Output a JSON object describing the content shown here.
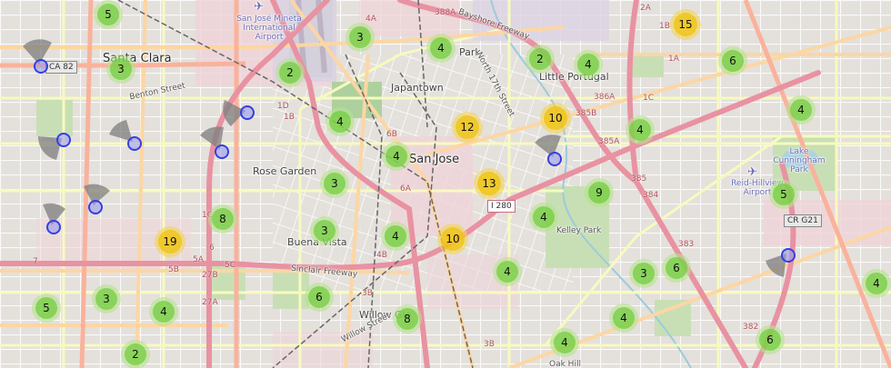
{
  "map": {
    "place_labels": [
      {
        "name": "santa-clara-label",
        "text": "Santa Clara",
        "cls": "city"
      },
      {
        "name": "san-jose-label",
        "text": "San Jose",
        "cls": "city"
      },
      {
        "name": "japantown-label",
        "text": "Japantown",
        "cls": "nb"
      },
      {
        "name": "little-portugal-label",
        "text": "Little Portugal",
        "cls": "nb"
      },
      {
        "name": "rose-garden-label",
        "text": "Rose Garden",
        "cls": "nb"
      },
      {
        "name": "buena-vista-label",
        "text": "Buena Vista",
        "cls": "nb"
      },
      {
        "name": "willow-glen-label",
        "text": "Willow Gle",
        "cls": "nb"
      },
      {
        "name": "kelley-park-label",
        "text": "Kelley Park",
        "cls": "small"
      },
      {
        "name": "park-label",
        "text": "Park",
        "cls": "nb"
      },
      {
        "name": "oak-hill-label",
        "text": "Oak Hill",
        "cls": "small"
      },
      {
        "name": "benton-street-label",
        "text": "Benton Street",
        "cls": "small"
      },
      {
        "name": "bayshore-freeway-label",
        "text": "Bayshore Freeway",
        "cls": "small"
      },
      {
        "name": "sinclair-freeway-label",
        "text": "Sinclair Freeway",
        "cls": "small"
      },
      {
        "name": "willow-street-label",
        "text": "Willow Street",
        "cls": "small"
      },
      {
        "name": "north-17th-street-label",
        "text": "North 17th Street",
        "cls": "small"
      },
      {
        "name": "lake-cunningham-park-label",
        "text": "Lake Cunningham Park",
        "cls": "blue"
      },
      {
        "name": "reid-hillview-airport-label",
        "text": "Reid-Hillview Airport",
        "cls": "blue"
      },
      {
        "name": "sjc-airport-label",
        "text": "San José Mineta International Airport",
        "cls": "blue"
      }
    ],
    "shields": [
      {
        "name": "ca-82-shield",
        "text": "CA 82"
      },
      {
        "name": "i-280-shield",
        "text": "I 280"
      },
      {
        "name": "cr-g21-shield",
        "text": "CR G21"
      },
      {
        "name": "exit-388a-label",
        "text": "388A"
      }
    ],
    "exits": [
      "1D",
      "1B",
      "1C",
      "5C",
      "5B",
      "5A",
      "27B",
      "27A",
      "6B",
      "6A",
      "4A",
      "4B",
      "3B",
      "385B",
      "385A",
      "386A",
      "385",
      "384",
      "383",
      "382",
      "2A",
      "1C",
      "1B",
      "1A",
      "6",
      "7",
      "3B"
    ],
    "clusters": [
      {
        "count": "5",
        "color": "green"
      },
      {
        "count": "3",
        "color": "green"
      },
      {
        "count": "3",
        "color": "green"
      },
      {
        "count": "2",
        "color": "green"
      },
      {
        "count": "4",
        "color": "green"
      },
      {
        "count": "2",
        "color": "green"
      },
      {
        "count": "4",
        "color": "green"
      },
      {
        "count": "15",
        "color": "yellow"
      },
      {
        "count": "6",
        "color": "green"
      },
      {
        "count": "4",
        "color": "green"
      },
      {
        "count": "12",
        "color": "yellow"
      },
      {
        "count": "10",
        "color": "yellow"
      },
      {
        "count": "4",
        "color": "green"
      },
      {
        "count": "4",
        "color": "green"
      },
      {
        "count": "4",
        "color": "green"
      },
      {
        "count": "3",
        "color": "green"
      },
      {
        "count": "13",
        "color": "yellow"
      },
      {
        "count": "9",
        "color": "green"
      },
      {
        "count": "5",
        "color": "green"
      },
      {
        "count": "8",
        "color": "green"
      },
      {
        "count": "3",
        "color": "green"
      },
      {
        "count": "4",
        "color": "green"
      },
      {
        "count": "10",
        "color": "yellow"
      },
      {
        "count": "4",
        "color": "green"
      },
      {
        "count": "19",
        "color": "yellow"
      },
      {
        "count": "4",
        "color": "green"
      },
      {
        "count": "3",
        "color": "green"
      },
      {
        "count": "6",
        "color": "green"
      },
      {
        "count": "4",
        "color": "green"
      },
      {
        "count": "5",
        "color": "green"
      },
      {
        "count": "3",
        "color": "green"
      },
      {
        "count": "4",
        "color": "green"
      },
      {
        "count": "6",
        "color": "green"
      },
      {
        "count": "8",
        "color": "green"
      },
      {
        "count": "4",
        "color": "green"
      },
      {
        "count": "4",
        "color": "green"
      },
      {
        "count": "6",
        "color": "green"
      },
      {
        "count": "2",
        "color": "green"
      }
    ],
    "cameras": [
      "camera-1",
      "camera-2",
      "camera-3",
      "camera-4",
      "camera-5",
      "camera-6",
      "camera-7",
      "camera-8",
      "camera-9",
      "camera-10"
    ],
    "colors": {
      "cluster_small": "#6ecc39",
      "cluster_medium": "#f0c20c",
      "camera_ring": "#3440e0",
      "motorway": "#e892a2",
      "trunk": "#f9b29c",
      "primary": "#fcd6a4",
      "secondary": "#f7fabf",
      "land": "#f2efe9",
      "park": "#add19e"
    }
  }
}
